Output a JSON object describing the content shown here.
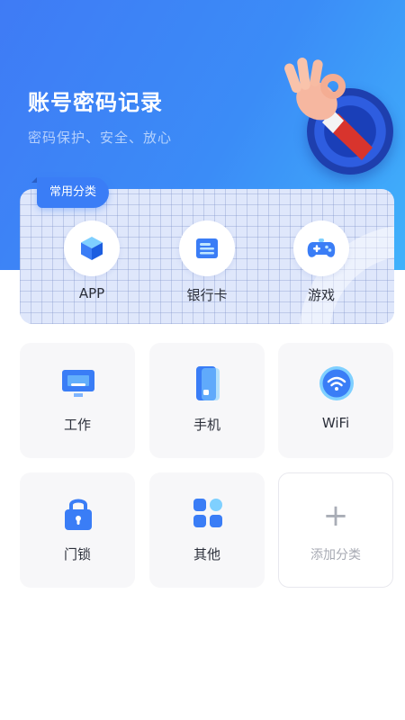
{
  "header": {
    "title": "账号密码记录",
    "subtitle": "密码保护、安全、放心"
  },
  "common": {
    "tag": "常用分类",
    "items": [
      {
        "label": "APP",
        "icon": "cube-icon"
      },
      {
        "label": "银行卡",
        "icon": "bank-card-icon"
      },
      {
        "label": "游戏",
        "icon": "gamepad-icon"
      }
    ]
  },
  "categories": [
    {
      "label": "工作",
      "icon": "monitor-icon"
    },
    {
      "label": "手机",
      "icon": "phone-icon"
    },
    {
      "label": "WiFi",
      "icon": "wifi-icon"
    },
    {
      "label": "门锁",
      "icon": "lock-icon"
    },
    {
      "label": "其他",
      "icon": "grid-icon"
    },
    {
      "label": "添加分类",
      "icon": "plus-icon"
    }
  ],
  "colors": {
    "primary": "#3a7df6",
    "header_gradient_start": "#3f7bf5",
    "header_gradient_end": "#40b2fb"
  }
}
